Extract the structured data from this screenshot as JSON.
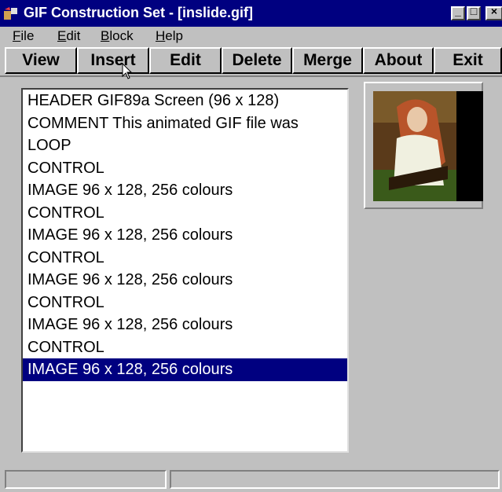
{
  "window": {
    "title": "GIF Construction Set - [inslide.gif]",
    "minimize_glyph": "_",
    "maximize_glyph": "□",
    "close_glyph": "×"
  },
  "menu": [
    "File",
    "Edit",
    "Block",
    "Help"
  ],
  "toolbar": {
    "view": "View",
    "insert": "Insert",
    "edit": "Edit",
    "delete": "Delete",
    "merge": "Merge",
    "about": "About",
    "exit": "Exit"
  },
  "blocks": [
    "HEADER GIF89a Screen (96 x 128)",
    "COMMENT This animated GIF file was",
    "LOOP",
    "CONTROL",
    "IMAGE 96 x 128, 256 colours",
    "CONTROL",
    "IMAGE 96 x 128, 256 colours",
    "CONTROL",
    "IMAGE 96 x 128, 256 colours",
    "CONTROL",
    "IMAGE 96 x 128, 256 colours",
    "CONTROL",
    "IMAGE 96 x 128, 256 colours"
  ],
  "selected_index": 12,
  "status": {
    "pane1": "",
    "pane2": ""
  },
  "colors": {
    "titlebar": "#000080",
    "face": "#c0c0c0",
    "selection": "#000080"
  }
}
